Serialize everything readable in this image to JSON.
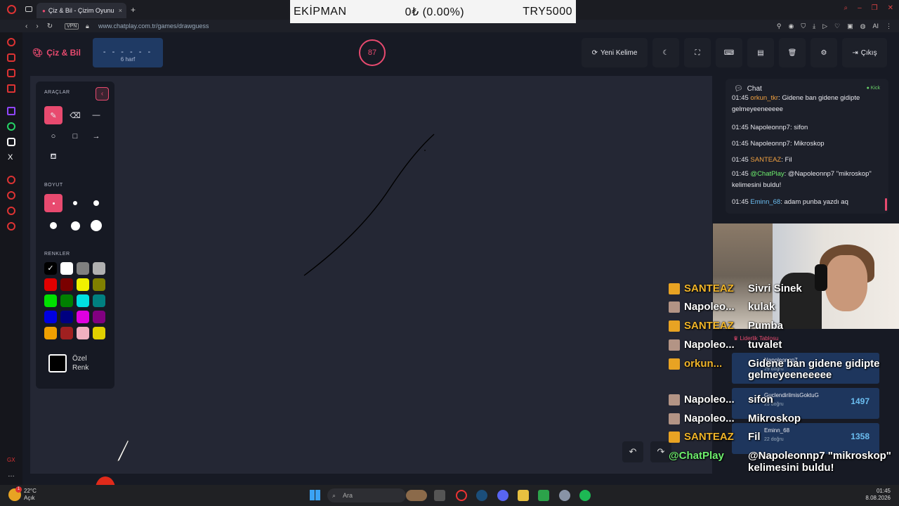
{
  "browser": {
    "tab_title": "Çiz & Bil - Çizim Oyunu",
    "url": "www.chatplay.com.tr/games/drawguess",
    "vpn_label": "VPN",
    "ai_label": "AI"
  },
  "overlay_bar": {
    "label": "EKİPMAN",
    "value": "0₺ (0.00%)",
    "goal": "TRY5000"
  },
  "game": {
    "logo": "Çiz & Bil",
    "word_mask": "- - - - - -",
    "word_length": "6 harf",
    "timer": "87",
    "buttons": {
      "new_word": "Yeni Kelime",
      "exit": "Çıkış"
    }
  },
  "tools": {
    "section_tools": "ARAÇLAR",
    "section_size": "BOYUT",
    "section_colors": "RENKLER",
    "custom_color": [
      "Özel",
      "Renk"
    ],
    "swatches": [
      "#000000",
      "#ffffff",
      "#808080",
      "#b0b0b0",
      "#e00000",
      "#7a0000",
      "#f0f000",
      "#808000",
      "#00e000",
      "#008000",
      "#00e0e0",
      "#008080",
      "#0000e0",
      "#000080",
      "#e000e0",
      "#800080",
      "#f0a000",
      "#a02020",
      "#f0b0c0",
      "#e0d000"
    ]
  },
  "chat": {
    "title": "Chat",
    "platform": "Kick",
    "messages": [
      {
        "time": "01:45",
        "user": "orkun_tkr",
        "user_color": "#f0a040",
        "text": "Gidene ban gidene gidipte gelmeyeeneeeee"
      },
      {
        "time": "01:45",
        "user": "Napoleonnp7",
        "user_color": "#e8e8ee",
        "text": "sifon"
      },
      {
        "time": "01:45",
        "user": "Napoleonnp7",
        "user_color": "#e8e8ee",
        "text": "Mikroskop"
      },
      {
        "time": "01:45",
        "user": "SANTEAZ",
        "user_color": "#f0a040",
        "text": "Fil"
      },
      {
        "time": "01:45",
        "user": "@ChatPlay",
        "user_color": "#6ef06e",
        "text": "@Napoleonnp7 \"mikroskop\" kelimesini buldu!"
      },
      {
        "time": "01:45",
        "user": "Eminn_68",
        "user_color": "#6bbdf0",
        "text": "adam punba yazdı aq"
      }
    ]
  },
  "stream_chat": [
    {
      "user": "SANTEAZ",
      "style": "gold",
      "badge": "crown",
      "text": "Sivri Sinek"
    },
    {
      "user": "Napoleo...",
      "style": "white",
      "badge": "avatar",
      "text": "kulak"
    },
    {
      "user": "SANTEAZ",
      "style": "gold",
      "badge": "crown",
      "text": "Pumba"
    },
    {
      "user": "Napoleo...",
      "style": "white",
      "badge": "avatar",
      "text": "tuvalet"
    },
    {
      "user": "orkun...",
      "style": "gold",
      "badge": "crown",
      "text": "Gidene ban gidene gidipte"
    },
    {
      "user": "",
      "style": "white",
      "badge": "",
      "text": "gelmeyeeneeeee"
    },
    {
      "user": "Napoleo...",
      "style": "white",
      "badge": "avatar",
      "text": "sifon"
    },
    {
      "user": "Napoleo...",
      "style": "white",
      "badge": "avatar",
      "text": "Mikroskop"
    },
    {
      "user": "SANTEAZ",
      "style": "gold",
      "badge": "crown",
      "text": "Fil"
    },
    {
      "user": "@ChatPlay",
      "style": "green",
      "badge": "",
      "text": "@Napoleonnp7 \"mikroskop\""
    },
    {
      "user": "",
      "style": "white",
      "badge": "",
      "text": "kelimesini buldu!"
    }
  ],
  "leaderboard": {
    "title": "Liderlik Tablosu",
    "rows": [
      {
        "name": "Napoleonnp7",
        "sub": "29 doğru",
        "points": ""
      },
      {
        "name": "GuclendirilmisGoktuG",
        "sub": "23 doğru",
        "points": "1497"
      },
      {
        "name": "Eminn_68",
        "sub": "22 doğru",
        "points": "1358"
      }
    ]
  },
  "taskbar": {
    "temp": "22°C",
    "weather": "Açık",
    "search": "Ara",
    "time": "01:45",
    "date": "8.08.2026",
    "badge": "1"
  }
}
